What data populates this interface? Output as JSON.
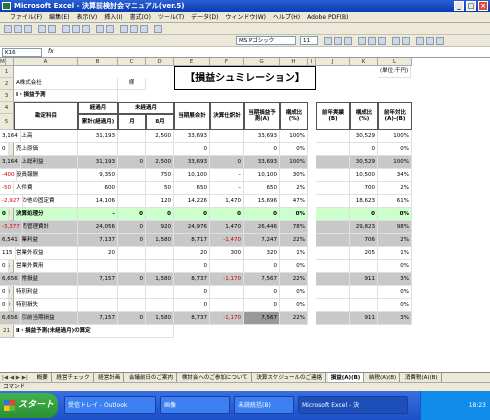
{
  "window": {
    "title": "Microsoft Excel - 決算前検討会マニュアル(ver.5)"
  },
  "menu": [
    "ファイル(F)",
    "編集(E)",
    "表示(V)",
    "挿入(I)",
    "書式(O)",
    "ツール(T)",
    "データ(D)",
    "ウィンドウ(W)",
    "ヘルプ(H)",
    "Adobe PDF(B)"
  ],
  "toolbar": {
    "font_name": "MS Pゴシック",
    "font_size": "11"
  },
  "formula_bar": {
    "cell_ref": "K16",
    "fx": "fx"
  },
  "columns": [
    "A",
    "B",
    "C",
    "D",
    "E",
    "F",
    "G",
    "H",
    "I",
    "J",
    "K",
    "L",
    "M"
  ],
  "row_numbers": [
    "1",
    "2",
    "3",
    "4",
    "5",
    "6",
    "7",
    "8",
    "9",
    "10",
    "11",
    "12",
    "13",
    "14",
    "15",
    "16",
    "17",
    "18",
    "19",
    "20",
    "21"
  ],
  "sheet": {
    "company": "A株式会社",
    "honorific": "様",
    "title": "【損益シュミレーション】",
    "unit": "(単位:千円)",
    "section": "Ⅰ・損益予測",
    "section2": "Ⅱ・損益予測(未経過月)の算定",
    "headers": {
      "item": "勘定科目",
      "elapsed": "経過月",
      "elapsed_total": "累計(経過月)",
      "unelapsed": "未経過月",
      "month": "月",
      "month8": "8月",
      "current_total": "当期展合計",
      "settlement": "決算仕訳計",
      "forecast": "当期損益予測(A)",
      "ratio": "構成比(%)",
      "prev": "前年実績(B)",
      "prev_ratio": "構成比(%)",
      "diff": "前年対比(A)-(B)"
    },
    "rows": [
      {
        "label": "売上高",
        "c": "31,193",
        "d": "",
        "e": "2,500",
        "f": "33,693",
        "g": "",
        "h": "33,693",
        "i": "100%",
        "k": "30,529",
        "l": "100%",
        "m": "3,164"
      },
      {
        "label": "売上原価",
        "c": "",
        "d": "",
        "e": "",
        "f": "0",
        "g": "",
        "h": "0",
        "i": "0%",
        "k": "0",
        "l": "0%",
        "m": "0"
      },
      {
        "label": "売上総利益",
        "c": "31,193",
        "d": "0",
        "e": "2,500",
        "f": "33,693",
        "g": "0",
        "h": "33,693",
        "i": "100%",
        "k": "30,529",
        "l": "100%",
        "m": "3,164"
      },
      {
        "label": "役員報酬",
        "c": "9,350",
        "d": "",
        "e": "750",
        "f": "10,100",
        "g": "–",
        "h": "10,100",
        "i": "30%",
        "k": "10,500",
        "l": "34%",
        "m": "-400"
      },
      {
        "label": "人件費",
        "c": "600",
        "d": "",
        "e": "50",
        "f": "650",
        "g": "–",
        "h": "650",
        "i": "2%",
        "k": "700",
        "l": "2%",
        "m": "-50"
      },
      {
        "label": "その他の固定費",
        "c": "14,106",
        "d": "",
        "e": "120",
        "f": "14,226",
        "g": "1,470",
        "h": "15,696",
        "i": "47%",
        "k": "18,623",
        "l": "61%",
        "m": "-2,927"
      },
      {
        "label": "決算処理分",
        "c": "–",
        "d": "0",
        "e": "0",
        "f": "0",
        "g": "0",
        "h": "0",
        "i": "0%",
        "k": "0",
        "l": "0%",
        "m": "0"
      },
      {
        "label": "販売管理費計",
        "c": "24,056",
        "d": "0",
        "e": "920",
        "f": "24,976",
        "g": "1,470",
        "h": "26,446",
        "i": "78%",
        "k": "29,823",
        "l": "98%",
        "m": "-3,377"
      },
      {
        "label": "営業利益",
        "c": "7,137",
        "d": "0",
        "e": "1,580",
        "f": "8,717",
        "g": "-1,470",
        "h": "7,247",
        "i": "22%",
        "k": "706",
        "l": "2%",
        "m": "6,541"
      },
      {
        "label": "営業外収益",
        "c": "20",
        "d": "",
        "e": "",
        "f": "20",
        "g": "300",
        "h": "320",
        "i": "1%",
        "k": "205",
        "l": "1%",
        "m": "115"
      },
      {
        "label": "営業外費用",
        "c": "",
        "d": "",
        "e": "",
        "f": "0",
        "g": "",
        "h": "0",
        "i": "0%",
        "k": "",
        "l": "0%",
        "m": "0"
      },
      {
        "label": "経常損益",
        "c": "7,157",
        "d": "0",
        "e": "1,580",
        "f": "8,737",
        "g": "-1,170",
        "h": "7,567",
        "i": "22%",
        "k": "911",
        "l": "3%",
        "m": "6,656"
      },
      {
        "label": "特別利益",
        "c": "",
        "d": "",
        "e": "",
        "f": "0",
        "g": "",
        "h": "0",
        "i": "0%",
        "k": "",
        "l": "0%",
        "m": "0"
      },
      {
        "label": "特別損失",
        "c": "",
        "d": "",
        "e": "",
        "f": "0",
        "g": "",
        "h": "0",
        "i": "0%",
        "k": "",
        "l": "0%",
        "m": "0"
      },
      {
        "label": "税引前当期損益",
        "c": "7,157",
        "d": "0",
        "e": "1,580",
        "f": "8,737",
        "g": "-1,170",
        "h": "7,567",
        "i": "22%",
        "k": "911",
        "l": "3%",
        "m": "6,656"
      }
    ]
  },
  "sheet_tabs": [
    "概要",
    "経営チェック",
    "経営計画",
    "会議前日のご案内",
    "検討会へのご参加について",
    "決算スケジュールのご連絡",
    "損益(A)(B)",
    "納税(A)(B)",
    "消費税(A)(B)"
  ],
  "status": "コマンド",
  "taskbar": {
    "start": "スタート",
    "items": [
      "受信トレイ - Outlook",
      "画像",
      "未読統括(B)",
      "Microsoft Excel - 決"
    ],
    "tray": "18:23"
  }
}
